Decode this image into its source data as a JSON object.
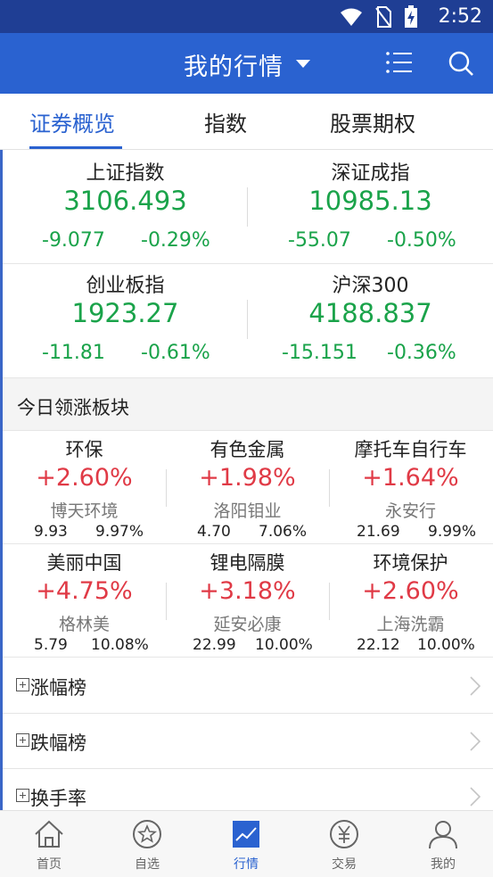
{
  "status_bar": {
    "time": "2:52"
  },
  "header": {
    "title": "我的行情"
  },
  "tabs": [
    {
      "label": "证券概览",
      "active": true
    },
    {
      "label": "指数",
      "active": false
    },
    {
      "label": "股票期权",
      "active": false
    }
  ],
  "indices": [
    {
      "name": "上证指数",
      "value": "3106.493",
      "change": "-9.077",
      "change_pct": "-0.29%"
    },
    {
      "name": "深证成指",
      "value": "10985.13",
      "change": "-55.07",
      "change_pct": "-0.50%"
    },
    {
      "name": "创业板指",
      "value": "1923.27",
      "change": "-11.81",
      "change_pct": "-0.61%"
    },
    {
      "name": "沪深300",
      "value": "4188.837",
      "change": "-15.151",
      "change_pct": "-0.36%"
    }
  ],
  "sectors_section": {
    "title": "今日领涨板块"
  },
  "sectors": [
    {
      "name": "环保",
      "pct": "+2.60%",
      "stock": "博天环境",
      "price": "9.93",
      "stock_pct": "9.97%"
    },
    {
      "name": "有色金属",
      "pct": "+1.98%",
      "stock": "洛阳钼业",
      "price": "4.70",
      "stock_pct": "7.06%"
    },
    {
      "name": "摩托车自行车",
      "pct": "+1.64%",
      "stock": "永安行",
      "price": "21.69",
      "stock_pct": "9.99%"
    },
    {
      "name": "美丽中国",
      "pct": "+4.75%",
      "stock": "格林美",
      "price": "5.79",
      "stock_pct": "10.08%"
    },
    {
      "name": "锂电隔膜",
      "pct": "+3.18%",
      "stock": "延安必康",
      "price": "22.99",
      "stock_pct": "10.00%"
    },
    {
      "name": "环境保护",
      "pct": "+2.60%",
      "stock": "上海洗霸",
      "price": "22.12",
      "stock_pct": "10.00%"
    }
  ],
  "rank_lists": [
    {
      "label": "涨幅榜"
    },
    {
      "label": "跌幅榜"
    },
    {
      "label": "换手率"
    }
  ],
  "bottom_nav": [
    {
      "label": "首页",
      "icon": "home-icon",
      "active": false
    },
    {
      "label": "自选",
      "icon": "star-icon",
      "active": false
    },
    {
      "label": "行情",
      "icon": "chart-icon",
      "active": true
    },
    {
      "label": "交易",
      "icon": "yen-icon",
      "active": false
    },
    {
      "label": "我的",
      "icon": "user-icon",
      "active": false
    }
  ],
  "colors": {
    "primary": "#2a62d0",
    "status_bar": "#1f3e94",
    "down": "#1aa34a",
    "up": "#e03a46"
  }
}
